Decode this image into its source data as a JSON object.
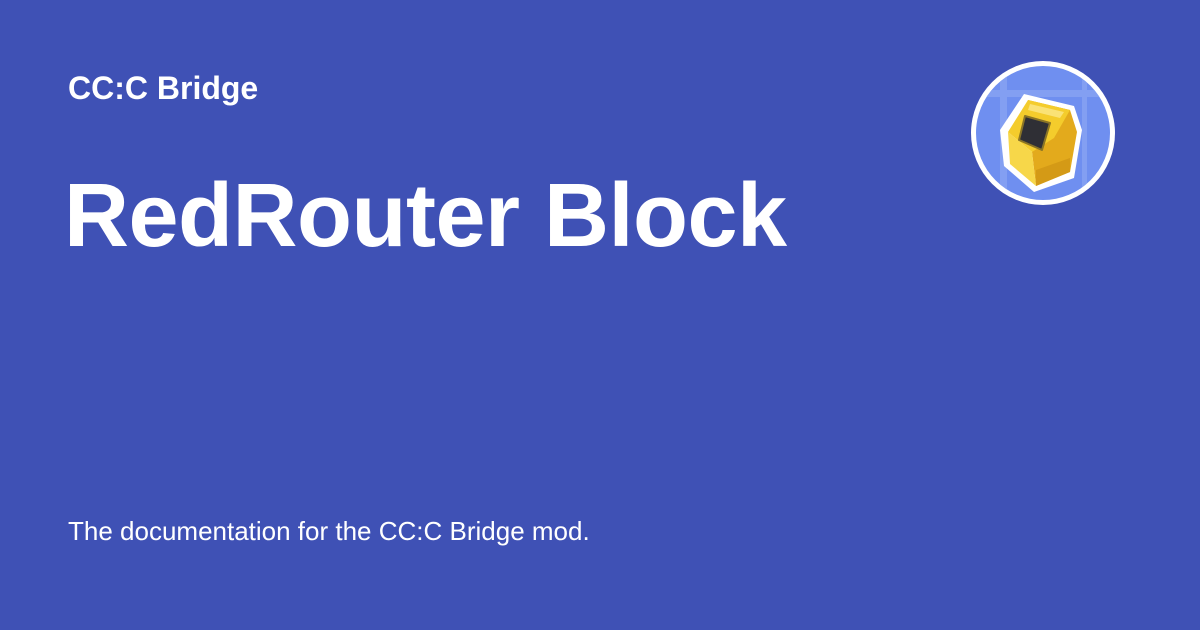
{
  "site": {
    "name": "CC:C Bridge"
  },
  "page": {
    "title": "RedRouter Block",
    "description": "The documentation for the CC:C Bridge mod."
  },
  "logo": {
    "icon": "yellow-cube-logo-icon"
  },
  "colors": {
    "background": "#3f51b5",
    "text": "#ffffff",
    "logo_ring": "#ffffff",
    "logo_disc": "#6f8ff0",
    "cube_face": "#f4cc2c",
    "cube_dark": "#e3aa1c",
    "cube_screen": "#2f2f35"
  }
}
